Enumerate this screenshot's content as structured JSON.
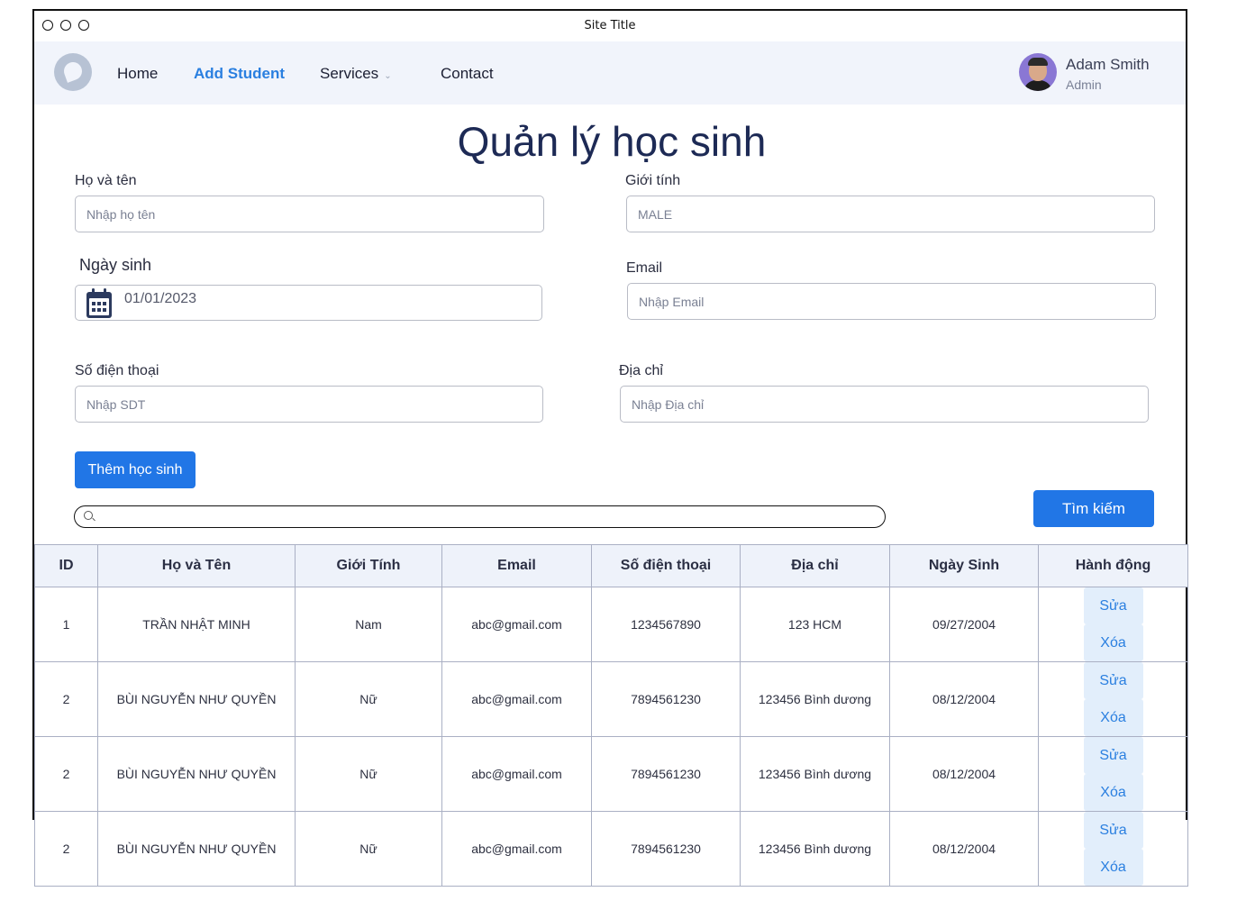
{
  "window": {
    "title": "Site Title"
  },
  "nav": {
    "items": [
      {
        "label": "Home"
      },
      {
        "label": "Add Student"
      },
      {
        "label": "Services"
      },
      {
        "label": "Contact"
      }
    ]
  },
  "user": {
    "name": "Adam Smith",
    "role": "Admin"
  },
  "page": {
    "title": "Quản lý học sinh"
  },
  "form": {
    "name": {
      "label": "Họ và tên",
      "placeholder": "Nhập họ tên"
    },
    "gender": {
      "label": "Giới tính",
      "value": "MALE"
    },
    "dob": {
      "label": "Ngày sinh",
      "value": "01/01/2023"
    },
    "email": {
      "label": "Email",
      "placeholder": "Nhập Email"
    },
    "phone": {
      "label": "Số điện thoại",
      "placeholder": "Nhập SDT"
    },
    "address": {
      "label": "Địa chỉ",
      "placeholder": "Nhập Địa chỉ"
    },
    "add_button": "Thêm học sinh",
    "search_button": "Tìm kiếm"
  },
  "table": {
    "headers": [
      "ID",
      "Họ và Tên",
      "Giới Tính",
      "Email",
      "Số điện thoại",
      "Địa chỉ",
      "Ngày Sinh",
      "Hành động"
    ],
    "rows": [
      [
        "1",
        "TRẦN NHẬT MINH",
        "Nam",
        "abc@gmail.com",
        "1234567890",
        "123 HCM",
        "09/27/2004"
      ],
      [
        "2",
        "BÙI NGUYỄN NHƯ QUYỀN",
        "Nữ",
        "abc@gmail.com",
        "7894561230",
        "123456 Bình dương",
        "08/12/2004"
      ],
      [
        "2",
        "BÙI NGUYỄN NHƯ QUYỀN",
        "Nữ",
        "abc@gmail.com",
        "7894561230",
        "123456 Bình dương",
        "08/12/2004"
      ],
      [
        "2",
        "BÙI NGUYỄN NHƯ QUYỀN",
        "Nữ",
        "abc@gmail.com",
        "7894561230",
        "123456 Bình dương",
        "08/12/2004"
      ]
    ],
    "edit_label": "Sửa",
    "delete_label": "Xóa"
  },
  "colors": {
    "accent": "#2176e6",
    "nav_bg": "#f1f4fb",
    "title": "#1d2a55"
  }
}
